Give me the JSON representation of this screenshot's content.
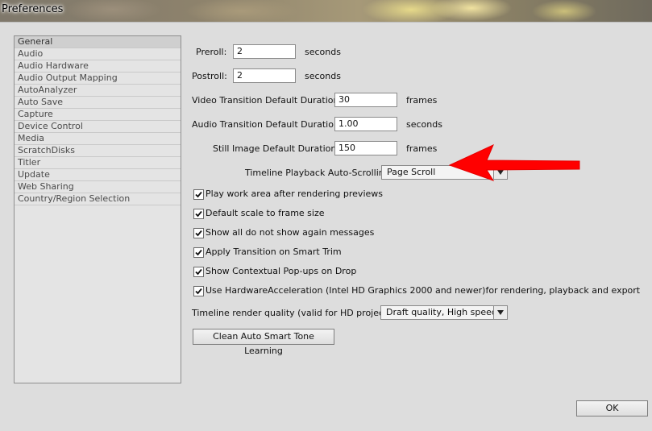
{
  "window": {
    "title": "Preferences"
  },
  "categories": [
    "General",
    "Audio",
    "Audio Hardware",
    "Audio Output Mapping",
    "AutoAnalyzer",
    "Auto Save",
    "Capture",
    "Device Control",
    "Media",
    "ScratchDisks",
    "Titler",
    "Update",
    "Web Sharing",
    "Country/Region Selection"
  ],
  "selected_category": "General",
  "general": {
    "preroll": {
      "label": "Preroll:",
      "value": "2",
      "unit": "seconds"
    },
    "postroll": {
      "label": "Postroll:",
      "value": "2",
      "unit": "seconds"
    },
    "video_transition": {
      "label": "Video Transition Default Duration:",
      "value": "30",
      "unit": "frames"
    },
    "audio_transition": {
      "label": "Audio Transition Default Duration:",
      "value": "1.00",
      "unit": "seconds"
    },
    "still_image": {
      "label": "Still Image Default Duration:",
      "value": "150",
      "unit": "frames"
    },
    "auto_scroll": {
      "label": "Timeline Playback Auto-Scrolling:",
      "value": "Page Scroll"
    },
    "checkboxes": [
      {
        "label": "Play work area after rendering previews",
        "checked": true
      },
      {
        "label": "Default scale to frame size",
        "checked": true
      },
      {
        "label": "Show all do not show again messages",
        "checked": true
      },
      {
        "label": "Apply Transition on Smart Trim",
        "checked": true
      },
      {
        "label": "Show Contextual Pop-ups on Drop",
        "checked": true
      },
      {
        "label": "Use HardwareAcceleration (Intel HD Graphics 2000 and newer)for rendering, playback and export",
        "checked": true
      }
    ],
    "render_quality": {
      "label": "Timeline render quality (valid for HD projects):",
      "value": "Draft quality, High speed"
    },
    "clean_button": "Clean Auto Smart Tone Learning"
  },
  "ok_button": "OK",
  "colors": {
    "annotation_arrow": "#ff0000"
  },
  "icons": {
    "dropdown": "chevron-down-icon",
    "checkbox": "checkmark-icon",
    "annotation": "red-arrow"
  }
}
